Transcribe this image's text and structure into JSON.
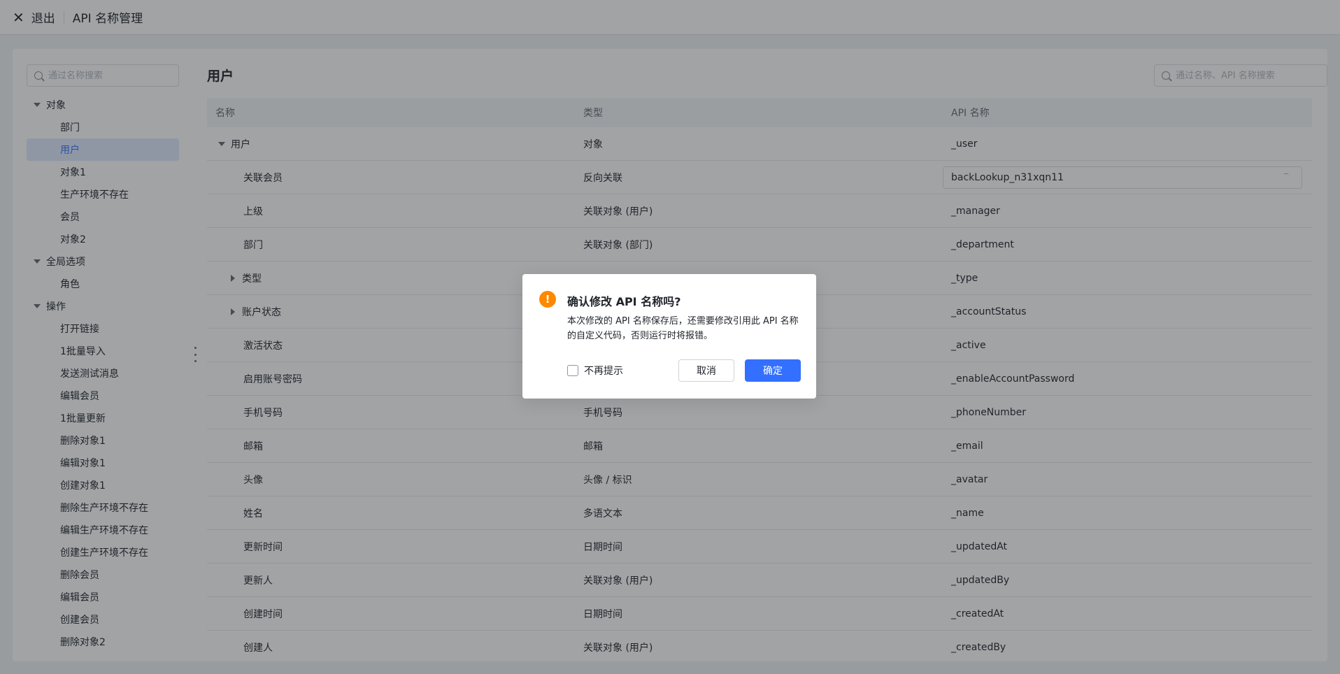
{
  "topbar": {
    "exit_label": "退出",
    "title": "API 名称管理"
  },
  "sidebar": {
    "search_placeholder": "通过名称搜索",
    "groups": [
      {
        "label": "对象",
        "items": [
          "部门",
          "用户",
          "对象1",
          "生产环境不存在",
          "会员",
          "对象2"
        ]
      },
      {
        "label": "全局选项",
        "items": [
          "角色"
        ]
      },
      {
        "label": "操作",
        "items": [
          "打开链接",
          "1批量导入",
          "发送测试消息",
          "编辑会员",
          "1批量更新",
          "删除对象1",
          "编辑对象1",
          "创建对象1",
          "删除生产环境不存在",
          "编辑生产环境不存在",
          "创建生产环境不存在",
          "删除会员",
          "编辑会员",
          "创建会员",
          "删除对象2"
        ]
      }
    ],
    "selected_item": "用户"
  },
  "main": {
    "title": "用户",
    "search_placeholder": "通过名称、API 名称搜索",
    "columns": [
      "名称",
      "类型",
      "API 名称"
    ],
    "rows": [
      {
        "name": "用户",
        "type": "对象",
        "api": "_user"
      },
      {
        "name": "关联会员",
        "type": "反向关联",
        "api": "backLookup_n31xqn11"
      },
      {
        "name": "上级",
        "type": "关联对象 (用户)",
        "api": "_manager"
      },
      {
        "name": "部门",
        "type": "关联对象 (部门)",
        "api": "_department"
      },
      {
        "name": "类型",
        "type": "",
        "api": "_type"
      },
      {
        "name": "账户状态",
        "type": "",
        "api": "_accountStatus"
      },
      {
        "name": "激活状态",
        "type": "",
        "api": "_active"
      },
      {
        "name": "启用账号密码",
        "type": "",
        "api": "_enableAccountPassword"
      },
      {
        "name": "手机号码",
        "type": "手机号码",
        "api": "_phoneNumber"
      },
      {
        "name": "邮箱",
        "type": "邮箱",
        "api": "_email"
      },
      {
        "name": "头像",
        "type": "头像 / 标识",
        "api": "_avatar"
      },
      {
        "name": "姓名",
        "type": "多语文本",
        "api": "_name"
      },
      {
        "name": "更新时间",
        "type": "日期时间",
        "api": "_updatedAt"
      },
      {
        "name": "更新人",
        "type": "关联对象 (用户)",
        "api": "_updatedBy"
      },
      {
        "name": "创建时间",
        "type": "日期时间",
        "api": "_createdAt"
      },
      {
        "name": "创建人",
        "type": "关联对象 (用户)",
        "api": "_createdBy"
      }
    ]
  },
  "dialog": {
    "title": "确认修改 API 名称吗?",
    "body": "本次修改的 API 名称保存后，还需要修改引用此 API 名称的自定义代码，否则运行时将报错。",
    "checkbox_label": "不再提示",
    "cancel_label": "取消",
    "ok_label": "确定",
    "icon": "warning-icon",
    "accent_color": "#3370ff",
    "warning_color": "#ff8800"
  }
}
